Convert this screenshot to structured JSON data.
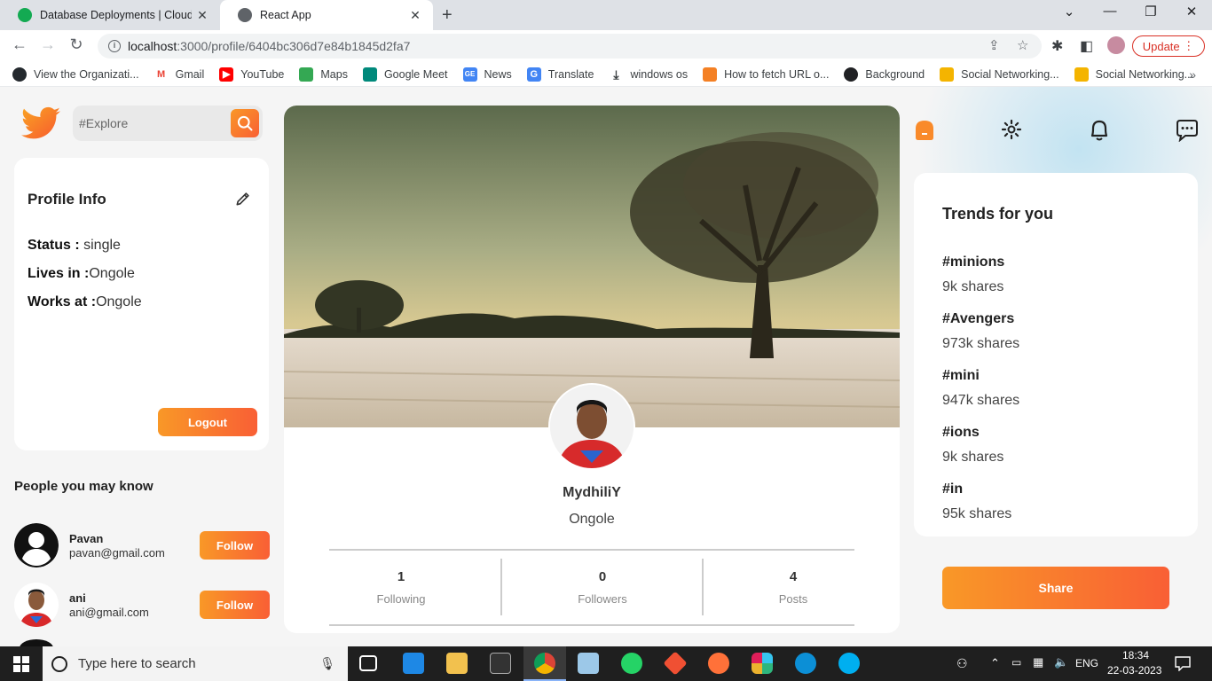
{
  "browser": {
    "tabs": [
      {
        "title": "Database Deployments | Cloud: M",
        "active": false,
        "favicon_color": "#13aa52"
      },
      {
        "title": "React App",
        "active": true,
        "favicon_color": "#5f6368"
      }
    ],
    "url_host": "localhost",
    "url_path": ":3000/profile/6404bc306d7e84b1845d2fa7",
    "update_label": "Update",
    "bookmarks": [
      {
        "label": "View the Organizati...",
        "icon": "github-icon",
        "color": "#24292e"
      },
      {
        "label": "Gmail",
        "icon": "gmail-icon",
        "color": "#ea4335"
      },
      {
        "label": "YouTube",
        "icon": "youtube-icon",
        "color": "#ff0000"
      },
      {
        "label": "Maps",
        "icon": "maps-icon",
        "color": "#34a853"
      },
      {
        "label": "Google Meet",
        "icon": "meet-icon",
        "color": "#00897b"
      },
      {
        "label": "News",
        "icon": "news-icon",
        "color": "#4285f4"
      },
      {
        "label": "Translate",
        "icon": "translate-icon",
        "color": "#4285f4"
      },
      {
        "label": "windows os",
        "icon": "download-icon",
        "color": "#3c4043"
      },
      {
        "label": "How to fetch URL o...",
        "icon": "stackoverflow-icon",
        "color": "#f48024"
      },
      {
        "label": "Background",
        "icon": "globe-icon",
        "color": "#202124"
      },
      {
        "label": "Social Networking...",
        "icon": "social-icon",
        "color": "#f4b400"
      },
      {
        "label": "Social Networking...",
        "icon": "social-icon",
        "color": "#f4b400"
      }
    ]
  },
  "app": {
    "search_placeholder": "#Explore",
    "profile_info": {
      "title": "Profile Info",
      "status_label": "Status :",
      "status_value": " single",
      "lives_label": "Lives in :",
      "lives_value": "Ongole",
      "works_label": "Works at :",
      "works_value": "Ongole",
      "logout_label": "Logout"
    },
    "people_title": "People you may know",
    "people": [
      {
        "name": "Pavan",
        "email": "pavan@gmail.com",
        "follow_label": "Follow"
      },
      {
        "name": "ani",
        "email": "ani@gmail.com",
        "follow_label": "Follow"
      }
    ],
    "profile": {
      "name": "MydhiliY",
      "location": "Ongole",
      "stats": [
        {
          "num": "1",
          "label": "Following"
        },
        {
          "num": "0",
          "label": "Followers"
        },
        {
          "num": "4",
          "label": "Posts"
        }
      ]
    },
    "trends": {
      "title": "Trends for you",
      "items": [
        {
          "tag": "#minions",
          "shares": "9k shares"
        },
        {
          "tag": "#Avengers",
          "shares": "973k shares"
        },
        {
          "tag": "#mini",
          "shares": "947k shares"
        },
        {
          "tag": "#ions",
          "shares": "9k shares"
        },
        {
          "tag": "#in",
          "shares": "95k shares"
        }
      ]
    },
    "share_label": "Share",
    "accent": "#f99827"
  },
  "taskbar": {
    "search_placeholder": "Type here to search",
    "lang": "ENG",
    "time": "18:34",
    "date": "22-03-2023"
  }
}
